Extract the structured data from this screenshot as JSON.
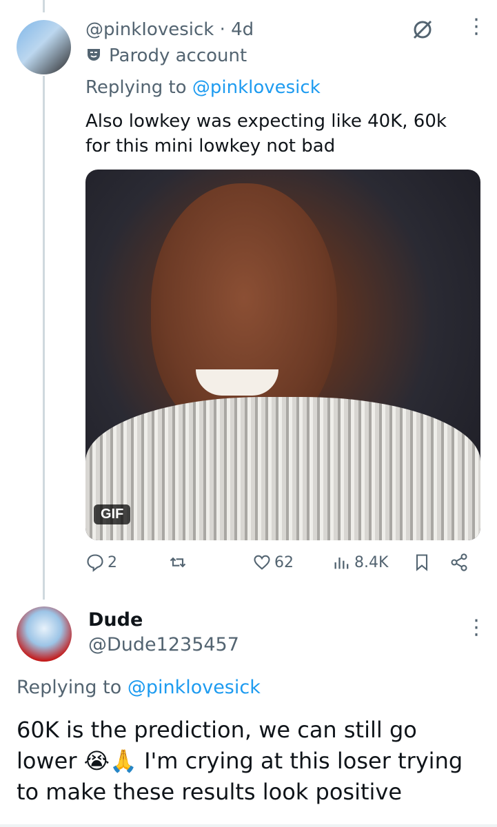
{
  "tweet1": {
    "handle": "@pinkIovesick",
    "separator": "·",
    "time": "4d",
    "badge_label": "Parody account",
    "replying_prefix": "Replying to",
    "replying_mention": "@pinklovesick",
    "text_lines": [
      "Also lowkey was expecting like 40K, 60k",
      "for this mini lowkey not bad"
    ],
    "media_badge": "GIF",
    "stats": {
      "replies": "2",
      "likes": "62",
      "views": "8.4K"
    },
    "icons": [
      "grok-icon",
      "more-icon",
      "reply-icon",
      "retweet-icon",
      "like-icon",
      "views-icon",
      "bookmark-icon",
      "share-icon"
    ]
  },
  "tweet2": {
    "author": "Dude",
    "handle": "@Dude1235457",
    "replying_prefix": "Replying to",
    "replying_mention": "@pinklovesick",
    "text_lines": [
      "60K is the prediction, we can still go",
      "lower 😭🙏 I'm crying at this loser trying",
      "to make these results look positive"
    ]
  },
  "colors": {
    "link": "#1d9bf0",
    "muted": "#536471",
    "text": "#0f1419",
    "thread_line": "#cfd9de"
  }
}
